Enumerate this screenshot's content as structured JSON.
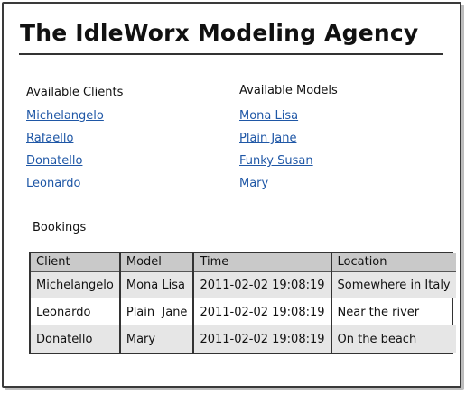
{
  "page": {
    "title": "The IdleWorx Modeling Agency"
  },
  "clients": {
    "heading": "Available Clients",
    "items": [
      "Michelangelo",
      "Rafaello",
      "Donatello",
      "Leonardo"
    ]
  },
  "models": {
    "heading": "Available Models",
    "items": [
      "Mona Lisa",
      "Plain Jane",
      "Funky Susan",
      "Mary"
    ]
  },
  "bookings": {
    "heading": "Bookings",
    "columns": [
      "Client",
      "Model",
      "Time",
      "Location"
    ],
    "rows": [
      [
        "Michelangelo",
        "Mona Lisa",
        "2011-02-02 19:08:19",
        "Somewhere in Italy"
      ],
      [
        "Leonardo",
        "Plain  Jane",
        "2011-02-02 19:08:19",
        "Near the river"
      ],
      [
        "Donatello",
        "Mary",
        "2011-02-02 19:08:19",
        "On the beach"
      ]
    ]
  },
  "colors": {
    "link": "#1f57a6",
    "header_bg": "#c9c9c9",
    "alt_row_bg": "#e6e6e6"
  }
}
